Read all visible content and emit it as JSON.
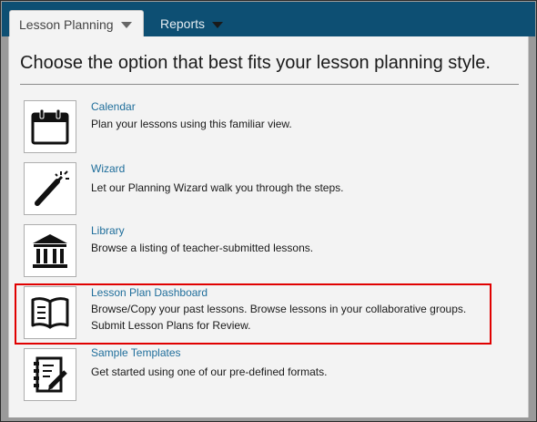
{
  "tabs": [
    {
      "label": "Lesson Planning"
    },
    {
      "label": "Reports"
    }
  ],
  "heading": "Choose the option that best fits your lesson planning style.",
  "options": [
    {
      "title": "Calendar",
      "desc1": "Plan your lessons using this familiar view.",
      "desc2": "",
      "icon": "calendar-icon"
    },
    {
      "title": "Wizard",
      "desc1": "Let our Planning Wizard walk you through the steps.",
      "desc2": "",
      "icon": "magic-wand-icon"
    },
    {
      "title": "Library",
      "desc1": "Browse a listing of teacher-submitted lessons.",
      "desc2": "",
      "icon": "library-icon"
    },
    {
      "title": "Lesson Plan Dashboard",
      "desc1": "Browse/Copy your past lessons. Browse lessons in your collaborative groups.",
      "desc2": "Submit Lesson Plans for Review.",
      "icon": "open-book-icon"
    },
    {
      "title": "Sample Templates",
      "desc1": "Get started using one of our pre-defined formats.",
      "desc2": "",
      "icon": "template-document-icon"
    }
  ],
  "colors": {
    "tab_bar": "#0d4f73",
    "link": "#1f6e9b",
    "highlight": "#e00000"
  }
}
